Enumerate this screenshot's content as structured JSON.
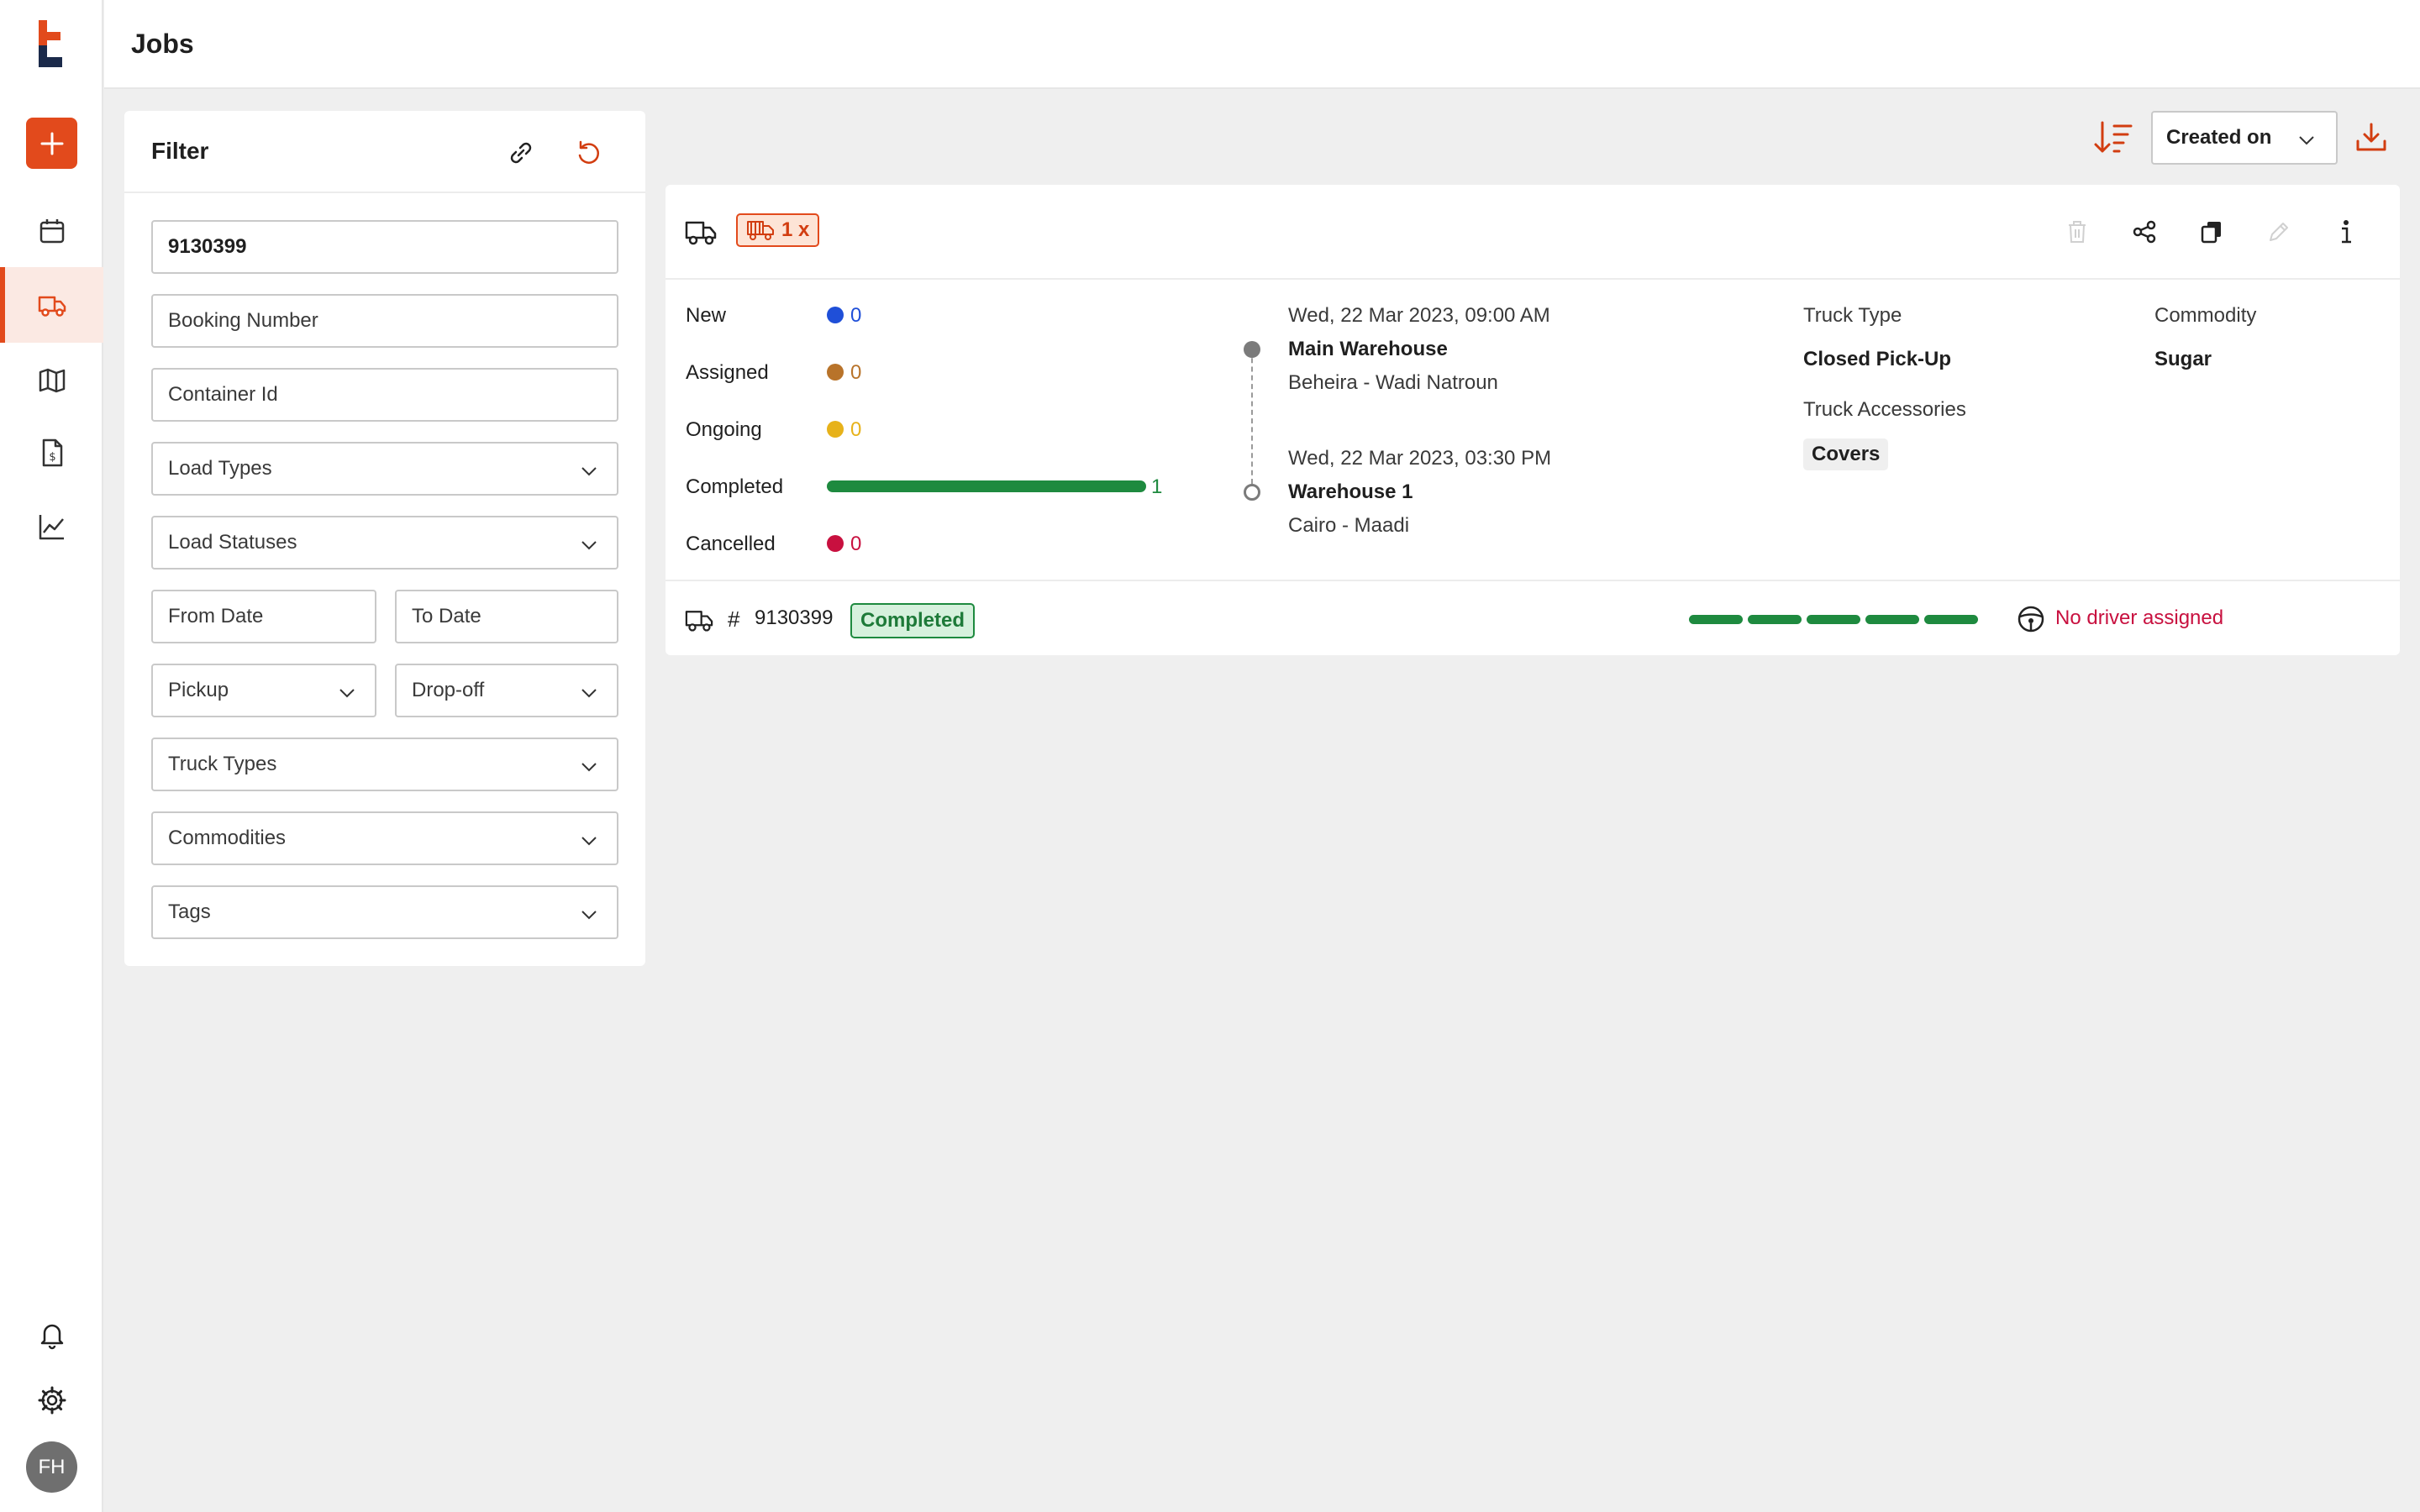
{
  "header": {
    "title": "Jobs"
  },
  "sidebar": {
    "avatar_initials": "FH",
    "items": [
      "add",
      "calendar",
      "jobs",
      "map",
      "invoices",
      "analytics",
      "notifications",
      "settings"
    ],
    "accent": "#e24a1c"
  },
  "filter": {
    "title": "Filter",
    "search_value": "9130399",
    "booking_placeholder": "Booking Number",
    "container_placeholder": "Container Id",
    "load_types": "Load Types",
    "load_statuses": "Load Statuses",
    "from_date": "From Date",
    "to_date": "To Date",
    "pickup": "Pickup",
    "dropoff": "Drop-off",
    "truck_types": "Truck Types",
    "commodities": "Commodities",
    "tags": "Tags"
  },
  "toolbar": {
    "sort_by": "Created on"
  },
  "job": {
    "quantity_badge": "1 x",
    "statuses": [
      {
        "label": "New",
        "count": "0",
        "color": "#1f4fd8"
      },
      {
        "label": "Assigned",
        "count": "0",
        "color": "#b8732a"
      },
      {
        "label": "Ongoing",
        "count": "0",
        "color": "#e7b21a"
      },
      {
        "label": "Completed",
        "count": "1",
        "color": "#1e8a3f"
      },
      {
        "label": "Cancelled",
        "count": "0",
        "color": "#c8103f"
      }
    ],
    "pickup": {
      "datetime": "Wed, 22 Mar 2023, 09:00 AM",
      "name": "Main Warehouse",
      "location": "Beheira - Wadi Natroun"
    },
    "dropoff": {
      "datetime": "Wed, 22 Mar 2023, 03:30 PM",
      "name": "Warehouse 1",
      "location": "Cairo - Maadi"
    },
    "truck_type_label": "Truck Type",
    "truck_type": "Closed Pick-Up",
    "accessories_label": "Truck Accessories",
    "accessory": "Covers",
    "commodity_label": "Commodity",
    "commodity": "Sugar",
    "load_hash": "#",
    "load_number": "9130399",
    "load_status": "Completed",
    "load_progress_steps_completed": 5,
    "load_progress_steps_total": 5,
    "driver": "No driver assigned"
  }
}
